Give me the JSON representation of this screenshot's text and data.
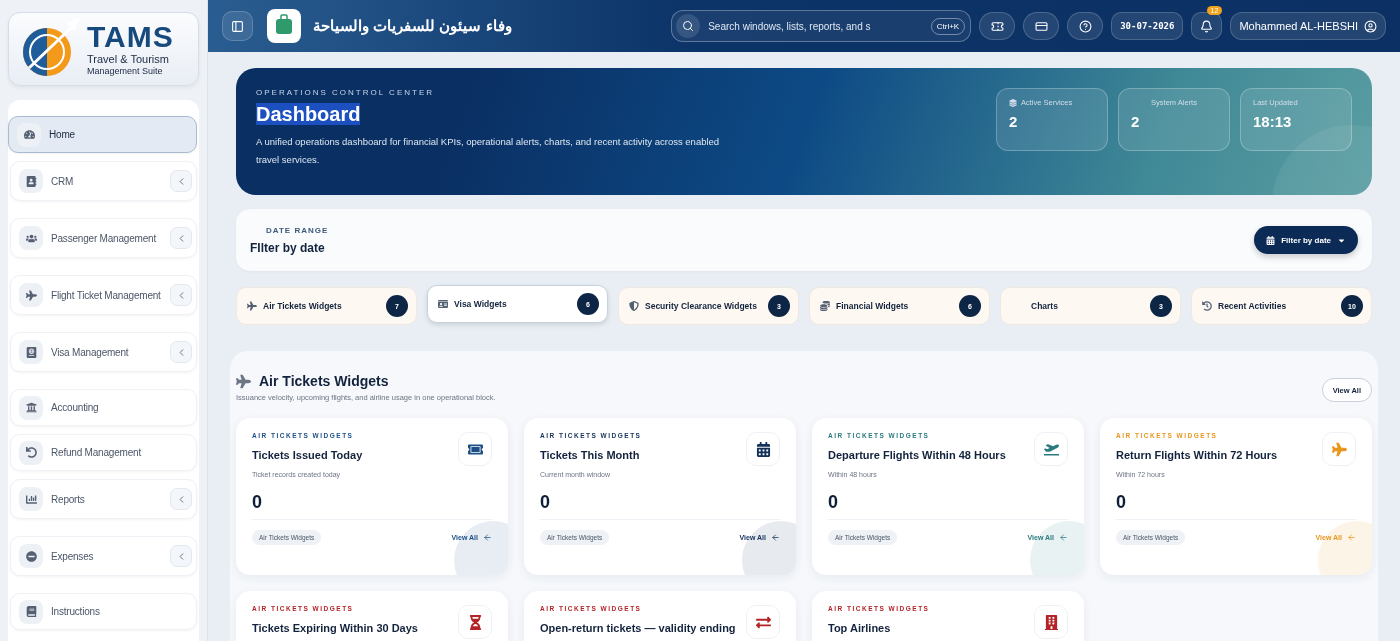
{
  "sidebar": {
    "logo": {
      "name": "TAMS",
      "line_1": "Travel & Tourism",
      "line_2": "Management Suite"
    },
    "items": [
      {
        "label": "Home",
        "kind": "link",
        "selected": true
      },
      {
        "label": "CRM",
        "kind": "group",
        "selected": false
      },
      {
        "label": "Passenger Management",
        "kind": "group",
        "selected": false
      },
      {
        "label": "Flight Ticket Management",
        "kind": "group",
        "selected": false
      },
      {
        "label": "Visa Management",
        "kind": "group",
        "selected": false
      },
      {
        "label": "Accounting",
        "kind": "link",
        "selected": false
      },
      {
        "label": "Refund Management",
        "kind": "link",
        "selected": false
      },
      {
        "label": "Reports",
        "kind": "group",
        "selected": false
      },
      {
        "label": "Expenses",
        "kind": "group",
        "selected": false
      },
      {
        "label": "Instructions",
        "kind": "link",
        "selected": false
      }
    ]
  },
  "header": {
    "company": "وفاء سيئون للسفريات والسياحة",
    "search": {
      "placeholder": "Search windows, lists, reports, and s",
      "shortcut": "Ctrl+K"
    },
    "date": "30-07-2026",
    "notifications": "12",
    "user": "Mohammed AL-HEBSHI"
  },
  "hero": {
    "eyebrow": "OPERATIONS CONTROL CENTER",
    "title": "Dashboard",
    "description": "A unified operations dashboard for financial KPIs, operational alerts, charts, and recent activity across enabled travel services.",
    "stats": [
      {
        "label": "Active Services",
        "value": "2"
      },
      {
        "label": "System Alerts",
        "value": "2"
      },
      {
        "label": "Last Updated",
        "value": "18:13"
      }
    ]
  },
  "filter": {
    "label": "DATE RANGE",
    "value": "FIlter by date",
    "button": "Filter by date"
  },
  "tabs": [
    {
      "label": "Air Tickets Widgets",
      "count": "7",
      "selected": false
    },
    {
      "label": "Visa Widgets",
      "count": "6",
      "selected": true
    },
    {
      "label": "Security Clearance Widgets",
      "count": "3",
      "selected": false
    },
    {
      "label": "Financial Widgets",
      "count": "6",
      "selected": false
    },
    {
      "label": "Charts",
      "count": "3",
      "selected": false
    },
    {
      "label": "Recent Activities",
      "count": "10",
      "selected": false
    }
  ],
  "section": {
    "title": "Air Tickets Widgets",
    "subtitle": "Issuance velocity, upcoming flights, and airline usage in one operational block.",
    "view_all": "View All",
    "cards": [
      {
        "eyebrow": "AIR TICKETS WIDGETS",
        "title": "Tickets Issued Today",
        "subtitle": "Ticket records created today",
        "value": "0",
        "tag": "Air Tickets Widgets",
        "link": "View All",
        "color": "#1d4f85"
      },
      {
        "eyebrow": "AIR TICKETS WIDGETS",
        "title": "Tickets This Month",
        "subtitle": "Current month window",
        "value": "0",
        "tag": "Air Tickets Widgets",
        "link": "View All",
        "color": "#14315a"
      },
      {
        "eyebrow": "AIR TICKETS WIDGETS",
        "title": "Departure Flights Within 48 Hours",
        "subtitle": "Within 48 hours",
        "value": "0",
        "tag": "Air Tickets Widgets",
        "link": "View All",
        "color": "#2a7b80"
      },
      {
        "eyebrow": "AIR TICKETS WIDGETS",
        "title": "Return Flights Within 72 Hours",
        "subtitle": "Within 72 hours",
        "value": "0",
        "tag": "Air Tickets Widgets",
        "link": "View All",
        "color": "#e8961c"
      },
      {
        "eyebrow": "AIR TICKETS WIDGETS",
        "title": "Tickets Expiring Within 30 Days",
        "color": "#b42328"
      },
      {
        "eyebrow": "AIR TICKETS WIDGETS",
        "title": "Open-return tickets — validity ending",
        "color": "#b42328"
      },
      {
        "eyebrow": "AIR TICKETS WIDGETS",
        "title": "Top Airlines",
        "color": "#b42328"
      }
    ]
  }
}
